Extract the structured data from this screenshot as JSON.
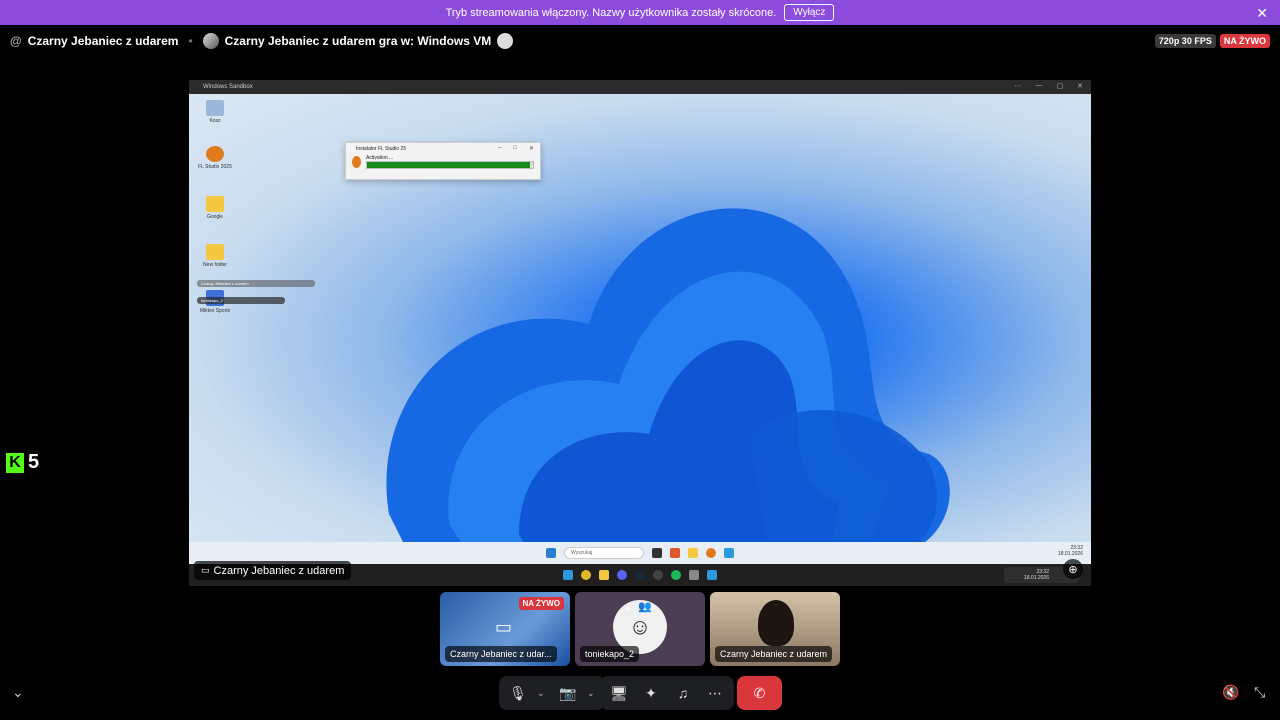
{
  "banner": {
    "text": "Tryb streamowania włączony. Nazwy użytkownika zostały skrócone.",
    "button_label": "Wyłącz",
    "close_glyph": "✕"
  },
  "header": {
    "at_glyph": "@",
    "channel_name": "Czarny Jebaniec z udarem",
    "activity": "Czarny Jebaniec z udarem gra w: Windows VM",
    "quality_badge": "720p 30 FPS",
    "live_badge": "NA ŻYWO"
  },
  "stream": {
    "window_title": "Windows Sandbox",
    "desktop_icons": [
      "Kosz",
      "FL Studio 2025",
      "Google",
      "New folder",
      "Miktex Sports"
    ],
    "installer": {
      "title": "Instalator FL Studio 25",
      "status": "Activation....",
      "progress": 0.98
    },
    "mini_overlay_1": "Czarny Jebaniec z udarem",
    "mini_overlay_2": "toniekapo_2",
    "search_placeholder": "Wyszukaj",
    "vm_time": "23:32",
    "vm_date": "18.01.2026",
    "host_time": "23:32",
    "host_date": "18.01.2026",
    "name_tag": "Czarny Jebaniec z udarem",
    "zoom_icon": "⊕"
  },
  "kick": {
    "logo_letter": "K",
    "count": "5"
  },
  "tiles": [
    {
      "label": "Czarny Jebaniec z udar...",
      "live": "NA ŻYWO"
    },
    {
      "label": "toniekapo_2"
    },
    {
      "label": "Czarny Jebaniec z udarem"
    }
  ],
  "controls": {
    "mic_icon": "🎙",
    "camera_icon": "📷",
    "share_icon": "🖥",
    "activities_icon": "✦",
    "soundboard_icon": "♫",
    "more_icon": "⋯",
    "hangup_icon": "✆",
    "chevron": "⌄"
  },
  "corner": {
    "collapse": "⌄",
    "mute_all": "🔇",
    "exit_fullscreen": "⤡"
  },
  "colors": {
    "banner": "#8c4bdb",
    "live_red": "#d9363e",
    "kick_green": "#53fc18",
    "hangup": "#da373c"
  }
}
